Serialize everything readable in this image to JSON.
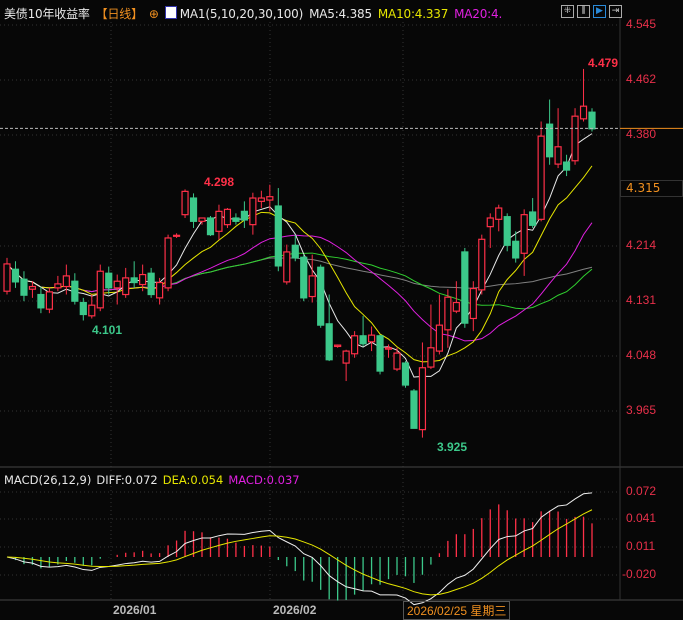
{
  "header": {
    "title": "美债10年收益率",
    "period": "【日线】",
    "ma_params": "MA1(5,10,20,30,100)",
    "ma5": "MA5:4.385",
    "ma10": "MA10:4.337",
    "ma20": "MA20:4.",
    "icons": [
      "crosshair-target-icon",
      "indicator-chart-icon"
    ],
    "tools": [
      "grid-icon",
      "bar-range-icon",
      "play-forward-icon",
      "skip-end-icon"
    ]
  },
  "colors": {
    "up": "#ff3048",
    "down": "#3cc88a",
    "ma5": "#e8e8e8",
    "ma10": "#e6e600",
    "ma20": "#e020e0",
    "ma30": "#30d030",
    "ma100": "#808080",
    "background": "#070707"
  },
  "chart_data": [
    {
      "type": "candlestick",
      "title": "美债10年收益率",
      "y_ticks": [
        "4.545",
        "4.462",
        "4.380",
        "4.214",
        "4.131",
        "4.048",
        "3.965"
      ],
      "ylim": [
        3.91,
        4.56
      ],
      "current_price_box": "4.315",
      "annotations": {
        "high_1": "4.298",
        "low_1": "4.101",
        "low_2": "3.925",
        "high_2": "4.479"
      },
      "x_labels": [
        "2026/01",
        "2026/02",
        "2026/02/25 星期三"
      ],
      "ohlc": [
        [
          4.145,
          4.195,
          4.14,
          4.186
        ],
        [
          4.178,
          4.19,
          4.15,
          4.159
        ],
        [
          4.163,
          4.175,
          4.13,
          4.139
        ],
        [
          4.148,
          4.16,
          4.135,
          4.152
        ],
        [
          4.14,
          4.152,
          4.112,
          4.12
        ],
        [
          4.118,
          4.15,
          4.112,
          4.144
        ],
        [
          4.15,
          4.168,
          4.145,
          4.156
        ],
        [
          4.152,
          4.185,
          4.14,
          4.168
        ],
        [
          4.16,
          4.172,
          4.125,
          4.13
        ],
        [
          4.128,
          4.135,
          4.101,
          4.11
        ],
        [
          4.108,
          4.14,
          4.104,
          4.124
        ],
        [
          4.12,
          4.185,
          4.115,
          4.175
        ],
        [
          4.172,
          4.182,
          4.14,
          4.15
        ],
        [
          4.15,
          4.17,
          4.125,
          4.16
        ],
        [
          4.14,
          4.18,
          4.135,
          4.165
        ],
        [
          4.165,
          4.19,
          4.15,
          4.158
        ],
        [
          4.155,
          4.185,
          4.145,
          4.17
        ],
        [
          4.172,
          4.18,
          4.135,
          4.14
        ],
        [
          4.135,
          4.165,
          4.125,
          4.158
        ],
        [
          4.15,
          4.23,
          4.145,
          4.225
        ],
        [
          4.228,
          4.232,
          4.225,
          4.229
        ],
        [
          4.26,
          4.298,
          4.255,
          4.295
        ],
        [
          4.285,
          4.292,
          4.24,
          4.25
        ],
        [
          4.25,
          4.255,
          4.245,
          4.255
        ],
        [
          4.255,
          4.258,
          4.228,
          4.23
        ],
        [
          4.235,
          4.275,
          4.222,
          4.265
        ],
        [
          4.245,
          4.27,
          4.24,
          4.268
        ],
        [
          4.255,
          4.262,
          4.245,
          4.25
        ],
        [
          4.265,
          4.28,
          4.24,
          4.252
        ],
        [
          4.245,
          4.293,
          4.23,
          4.285
        ],
        [
          4.28,
          4.296,
          4.27,
          4.285
        ],
        [
          4.282,
          4.305,
          4.265,
          4.287
        ],
        [
          4.273,
          4.3,
          4.175,
          4.183
        ],
        [
          4.159,
          4.215,
          4.155,
          4.204
        ],
        [
          4.214,
          4.23,
          4.19,
          4.195
        ],
        [
          4.196,
          4.2,
          4.13,
          4.135
        ],
        [
          4.137,
          4.2,
          4.128,
          4.168
        ],
        [
          4.181,
          4.185,
          4.09,
          4.094
        ],
        [
          4.096,
          4.14,
          4.04,
          4.042
        ],
        [
          4.062,
          4.065,
          4.06,
          4.064
        ],
        [
          4.037,
          4.057,
          4.01,
          4.055
        ],
        [
          4.051,
          4.085,
          4.045,
          4.078
        ],
        [
          4.078,
          4.108,
          4.062,
          4.066
        ],
        [
          4.069,
          4.092,
          4.055,
          4.079
        ],
        [
          4.078,
          4.08,
          4.02,
          4.025
        ],
        [
          4.058,
          4.065,
          4.045,
          4.06
        ],
        [
          4.028,
          4.06,
          4.025,
          4.052
        ],
        [
          4.037,
          4.04,
          4.0,
          4.004
        ],
        [
          3.995,
          3.998,
          3.939,
          3.939
        ],
        [
          3.937,
          4.068,
          3.925,
          4.03
        ],
        [
          4.031,
          4.125,
          4.028,
          4.06
        ],
        [
          4.055,
          4.14,
          4.05,
          4.094
        ],
        [
          4.087,
          4.148,
          4.06,
          4.136
        ],
        [
          4.115,
          4.16,
          4.112,
          4.128
        ],
        [
          4.204,
          4.21,
          4.09,
          4.097
        ],
        [
          4.104,
          4.16,
          4.085,
          4.149
        ],
        [
          4.147,
          4.23,
          4.14,
          4.223
        ],
        [
          4.242,
          4.262,
          4.21,
          4.255
        ],
        [
          4.253,
          4.275,
          4.235,
          4.27
        ],
        [
          4.257,
          4.262,
          4.205,
          4.214
        ],
        [
          4.22,
          4.235,
          4.188,
          4.195
        ],
        [
          4.202,
          4.268,
          4.168,
          4.26
        ],
        [
          4.264,
          4.285,
          4.24,
          4.244
        ],
        [
          4.253,
          4.4,
          4.25,
          4.378
        ],
        [
          4.396,
          4.433,
          4.335,
          4.347
        ],
        [
          4.336,
          4.42,
          4.33,
          4.362
        ],
        [
          4.339,
          4.35,
          4.318,
          4.327
        ],
        [
          4.341,
          4.42,
          4.335,
          4.408
        ],
        [
          4.404,
          4.479,
          4.4,
          4.423
        ],
        [
          4.414,
          4.42,
          4.385,
          4.389
        ]
      ],
      "moving_averages": [
        5,
        10,
        20,
        30,
        100
      ]
    },
    {
      "type": "macd",
      "params": "MACD(26,12,9)",
      "diff": "DIFF:0.072",
      "dea": "DEA:0.054",
      "macd": "MACD:0.037",
      "y_ticks": [
        "0.072",
        "0.041",
        "0.011",
        "-0.020"
      ],
      "ylim": [
        -0.035,
        0.075
      ]
    }
  ]
}
